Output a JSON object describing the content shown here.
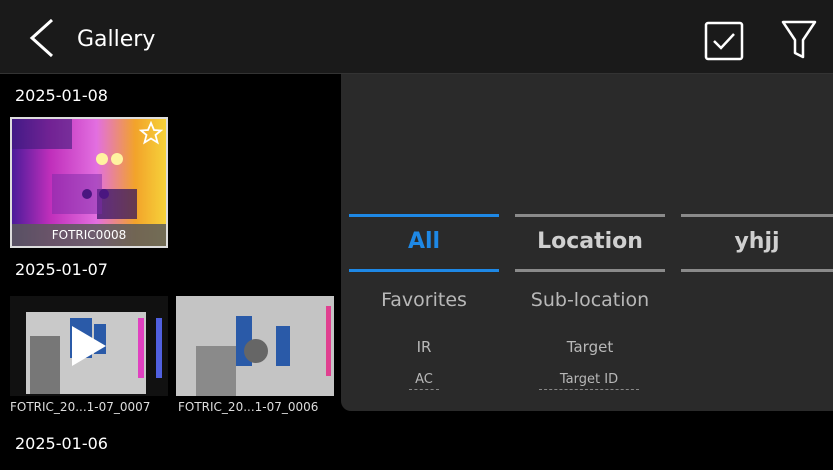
{
  "header": {
    "title": "Gallery"
  },
  "icons": {
    "back": "chevron-left-icon",
    "select": "checkbox-icon",
    "filter": "filter-icon",
    "favorite": "star-icon",
    "play": "play-icon"
  },
  "colors": {
    "accent": "#1e88e5",
    "panel": "#2a2a2a",
    "topbar": "#1a1a1a"
  },
  "gallery": {
    "groups": [
      {
        "date": "2025-01-08",
        "items": [
          {
            "caption": "FOTRIC0008",
            "type": "image",
            "favorite": false
          }
        ]
      },
      {
        "date": "2025-01-07",
        "items": [
          {
            "caption": "FOTRIC_20...1-07_0007",
            "type": "video"
          },
          {
            "caption": "FOTRIC_20...1-07_0006",
            "type": "image"
          }
        ]
      },
      {
        "date": "2025-01-06",
        "items": []
      }
    ]
  },
  "filter_panel": {
    "tabs": [
      {
        "label": "All",
        "active": true
      },
      {
        "label": "Location",
        "active": false
      },
      {
        "label": "yhjj",
        "active": false
      }
    ],
    "options": [
      {
        "label": "Favorites"
      },
      {
        "label": "Sub-location"
      },
      {
        "label": "IR"
      },
      {
        "label": "Target"
      },
      {
        "label": "AC"
      },
      {
        "label": "Target ID"
      }
    ]
  }
}
